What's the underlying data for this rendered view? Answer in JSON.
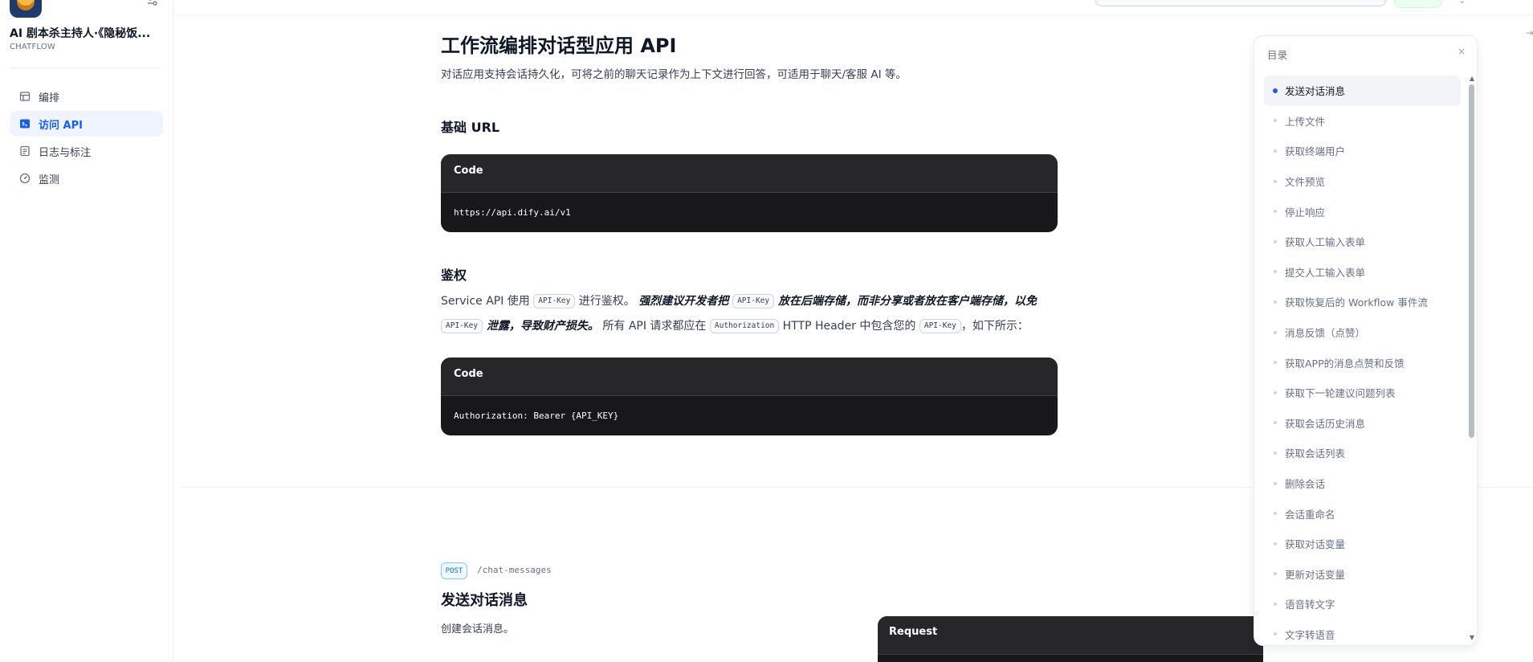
{
  "app": {
    "title": "AI 剧本杀主持人·《隐秘饭...",
    "mode": "CHATFLOW"
  },
  "sidebar": {
    "items": [
      {
        "label": "编排",
        "icon": "layout-icon",
        "active": false
      },
      {
        "label": "访问 API",
        "icon": "terminal-icon",
        "active": true
      },
      {
        "label": "日志与标注",
        "icon": "file-list-icon",
        "active": false
      },
      {
        "label": "监测",
        "icon": "dashboard-icon",
        "active": false
      }
    ]
  },
  "main": {
    "title": "工作流编排对话型应用 API",
    "lead": "对话应用支持会话持久化，可将之前的聊天记录作为上下文进行回答，可适用于聊天/客服 AI 等。",
    "base_url": {
      "heading": "基础 URL",
      "code_label": "Code",
      "code": "https://api.dify.ai/v1"
    },
    "auth": {
      "heading": "鉴权",
      "t1": "Service API 使用 ",
      "chip_api_key": "API-Key",
      "t2": " 进行鉴权。 ",
      "em1": "强烈建议开发者把 ",
      "em2": " 放在后端存储，而非分享或者放在客户端存储，以免 ",
      "em3": " 泄露，导致财产损失。",
      "t3": " 所有 API 请求都应在 ",
      "chip_authorization": "Authorization",
      "t4": " HTTP Header 中包含您的 ",
      "t5": "，如下所示：",
      "code_label": "Code",
      "code": "Authorization: Bearer {API_KEY}"
    },
    "endpoint": {
      "method": "POST",
      "path": "/chat-messages",
      "heading": "发送对话消息",
      "description": "创建会话消息。"
    },
    "request_label": "Request"
  },
  "toc": {
    "title": "目录",
    "close": "×",
    "items": [
      "发送对话消息",
      "上传文件",
      "获取终端用户",
      "文件预览",
      "停止响应",
      "获取人工输入表单",
      "提交人工输入表单",
      "获取恢复后的 Workflow 事件流",
      "消息反馈（点赞）",
      "获取APP的消息点赞和反馈",
      "获取下一轮建议问题列表",
      "获取会话历史消息",
      "获取会话列表",
      "删除会话",
      "会话重命名",
      "获取对话变量",
      "更新对话变量",
      "语音转文字",
      "文字转语音"
    ],
    "active_index": 0
  },
  "colors": {
    "accent": "#155eef",
    "code_bg": "#18181b",
    "code_header": "#27272a",
    "post_badge": "#1570ef"
  }
}
